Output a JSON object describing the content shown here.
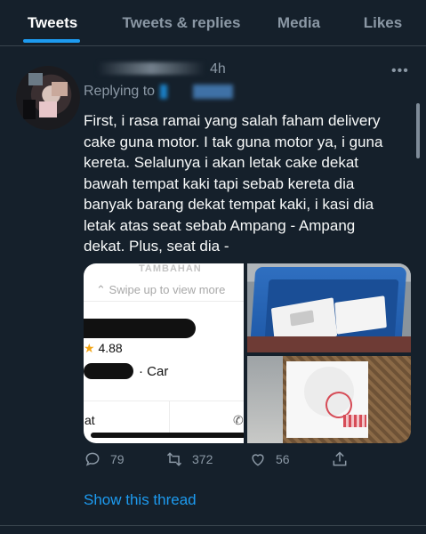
{
  "tabs": [
    {
      "label": "Tweets",
      "active": true
    },
    {
      "label": "Tweets & replies",
      "active": false
    },
    {
      "label": "Media",
      "active": false
    },
    {
      "label": "Likes",
      "active": false
    }
  ],
  "tweet": {
    "time": "4h",
    "replying_to_label": "Replying to",
    "more_icon": "more-horizontal-icon",
    "text_lines": [
      "First, i rasa ramai yang salah faham delivery",
      "cake guna motor. I tak guna motor ya, i guna",
      "kereta. Selalunya i akan letak cake dekat",
      "bawah tempat kaki tapi sebab kereta dia",
      "banyak barang dekat tempat kaki, i kasi dia",
      "letak atas seat sebab Ampang - Ampang",
      "dekat. Plus, seat dia -"
    ],
    "media": {
      "screenshot": {
        "header": "TAMBAHAN",
        "swipe_hint": "Swipe up to view more",
        "rating": "4.88",
        "vehicle": "· Car",
        "partial_text": "at"
      }
    },
    "actions": {
      "replies": "79",
      "retweets": "372",
      "likes": "56"
    },
    "show_thread": "Show this thread"
  },
  "colors": {
    "background": "#15202b",
    "accent": "#1d9bf0",
    "muted": "#8b98a5",
    "text": "#f7f9f9"
  }
}
